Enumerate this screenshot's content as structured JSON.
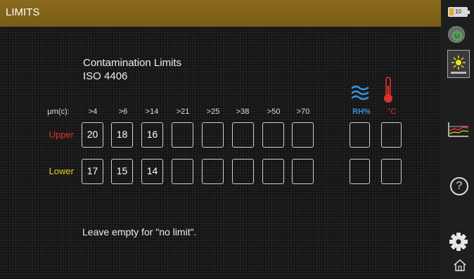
{
  "title": "LIMITS",
  "battery_text": "10",
  "heading": {
    "line1": "Contamination Limits",
    "line2": "ISO 4406"
  },
  "columns": {
    "unit_label": "µm(c):",
    "sizes": [
      ">4",
      ">6",
      ">14",
      ">21",
      ">25",
      ">38",
      ">50",
      ">70"
    ],
    "rh_label": "RH%",
    "temp_label": "°C"
  },
  "rows": {
    "upper": {
      "label": "Upper",
      "values": [
        "20",
        "18",
        "16",
        "",
        "",
        "",
        "",
        ""
      ],
      "rh": "",
      "temp": ""
    },
    "lower": {
      "label": "Lower",
      "values": [
        "17",
        "15",
        "14",
        "",
        "",
        "",
        "",
        ""
      ],
      "rh": "",
      "temp": ""
    }
  },
  "footer_note": "Leave empty for \"no limit\".",
  "help_symbol": "?",
  "colors": {
    "title_bar": "#7f611a",
    "upper_label": "#e0312a",
    "lower_label": "#e8d21c",
    "rh_accent": "#3a8fd8",
    "temp_accent": "#e0312a",
    "power_green": "#3bc43b"
  }
}
